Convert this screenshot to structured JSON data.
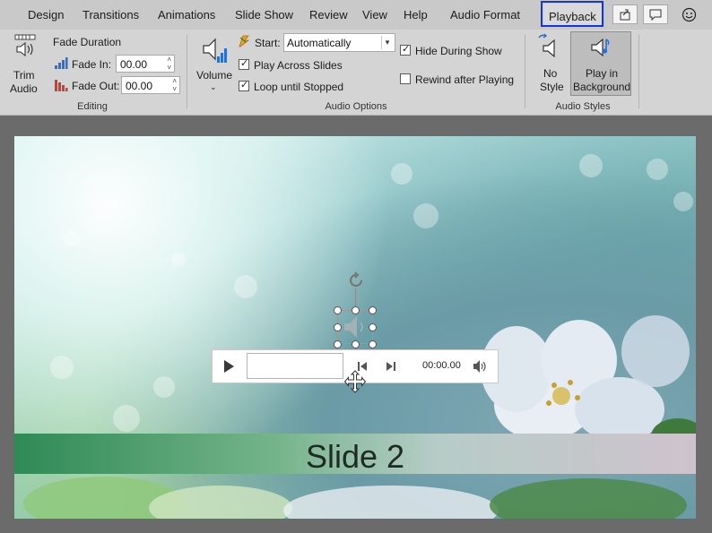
{
  "tabs": {
    "items": [
      "Design",
      "Transitions",
      "Animations",
      "Slide Show",
      "Review",
      "View",
      "Help",
      "Audio Format"
    ],
    "active": "Playback"
  },
  "ribbon": {
    "editing": {
      "trim_audio_line1": "Trim",
      "trim_audio_line2": "Audio",
      "fade_duration": "Fade Duration",
      "fade_in_label": "Fade In:",
      "fade_in_value": "00.00",
      "fade_out_label": "Fade Out:",
      "fade_out_value": "00.00",
      "group_label": "Editing"
    },
    "audio_options": {
      "volume_label": "Volume",
      "start_label": "Start:",
      "start_value": "Automatically",
      "play_across_slides": "Play Across Slides",
      "loop_until_stopped": "Loop until Stopped",
      "hide_during_show": "Hide During Show",
      "rewind_after_playing": "Rewind after Playing",
      "group_label": "Audio Options"
    },
    "audio_styles": {
      "no_style_line1": "No",
      "no_style_line2": "Style",
      "play_bg_line1": "Play in",
      "play_bg_line2": "Background",
      "group_label": "Audio Styles"
    },
    "checks": {
      "play_across_slides": true,
      "loop_until_stopped": true,
      "hide_during_show": true,
      "rewind_after_playing": false
    }
  },
  "slide": {
    "title": "Slide 2",
    "player_time": "00:00.00"
  },
  "colors": {
    "accent_outline": "#1133ee",
    "ribbon_bg": "#d4d4d4"
  }
}
